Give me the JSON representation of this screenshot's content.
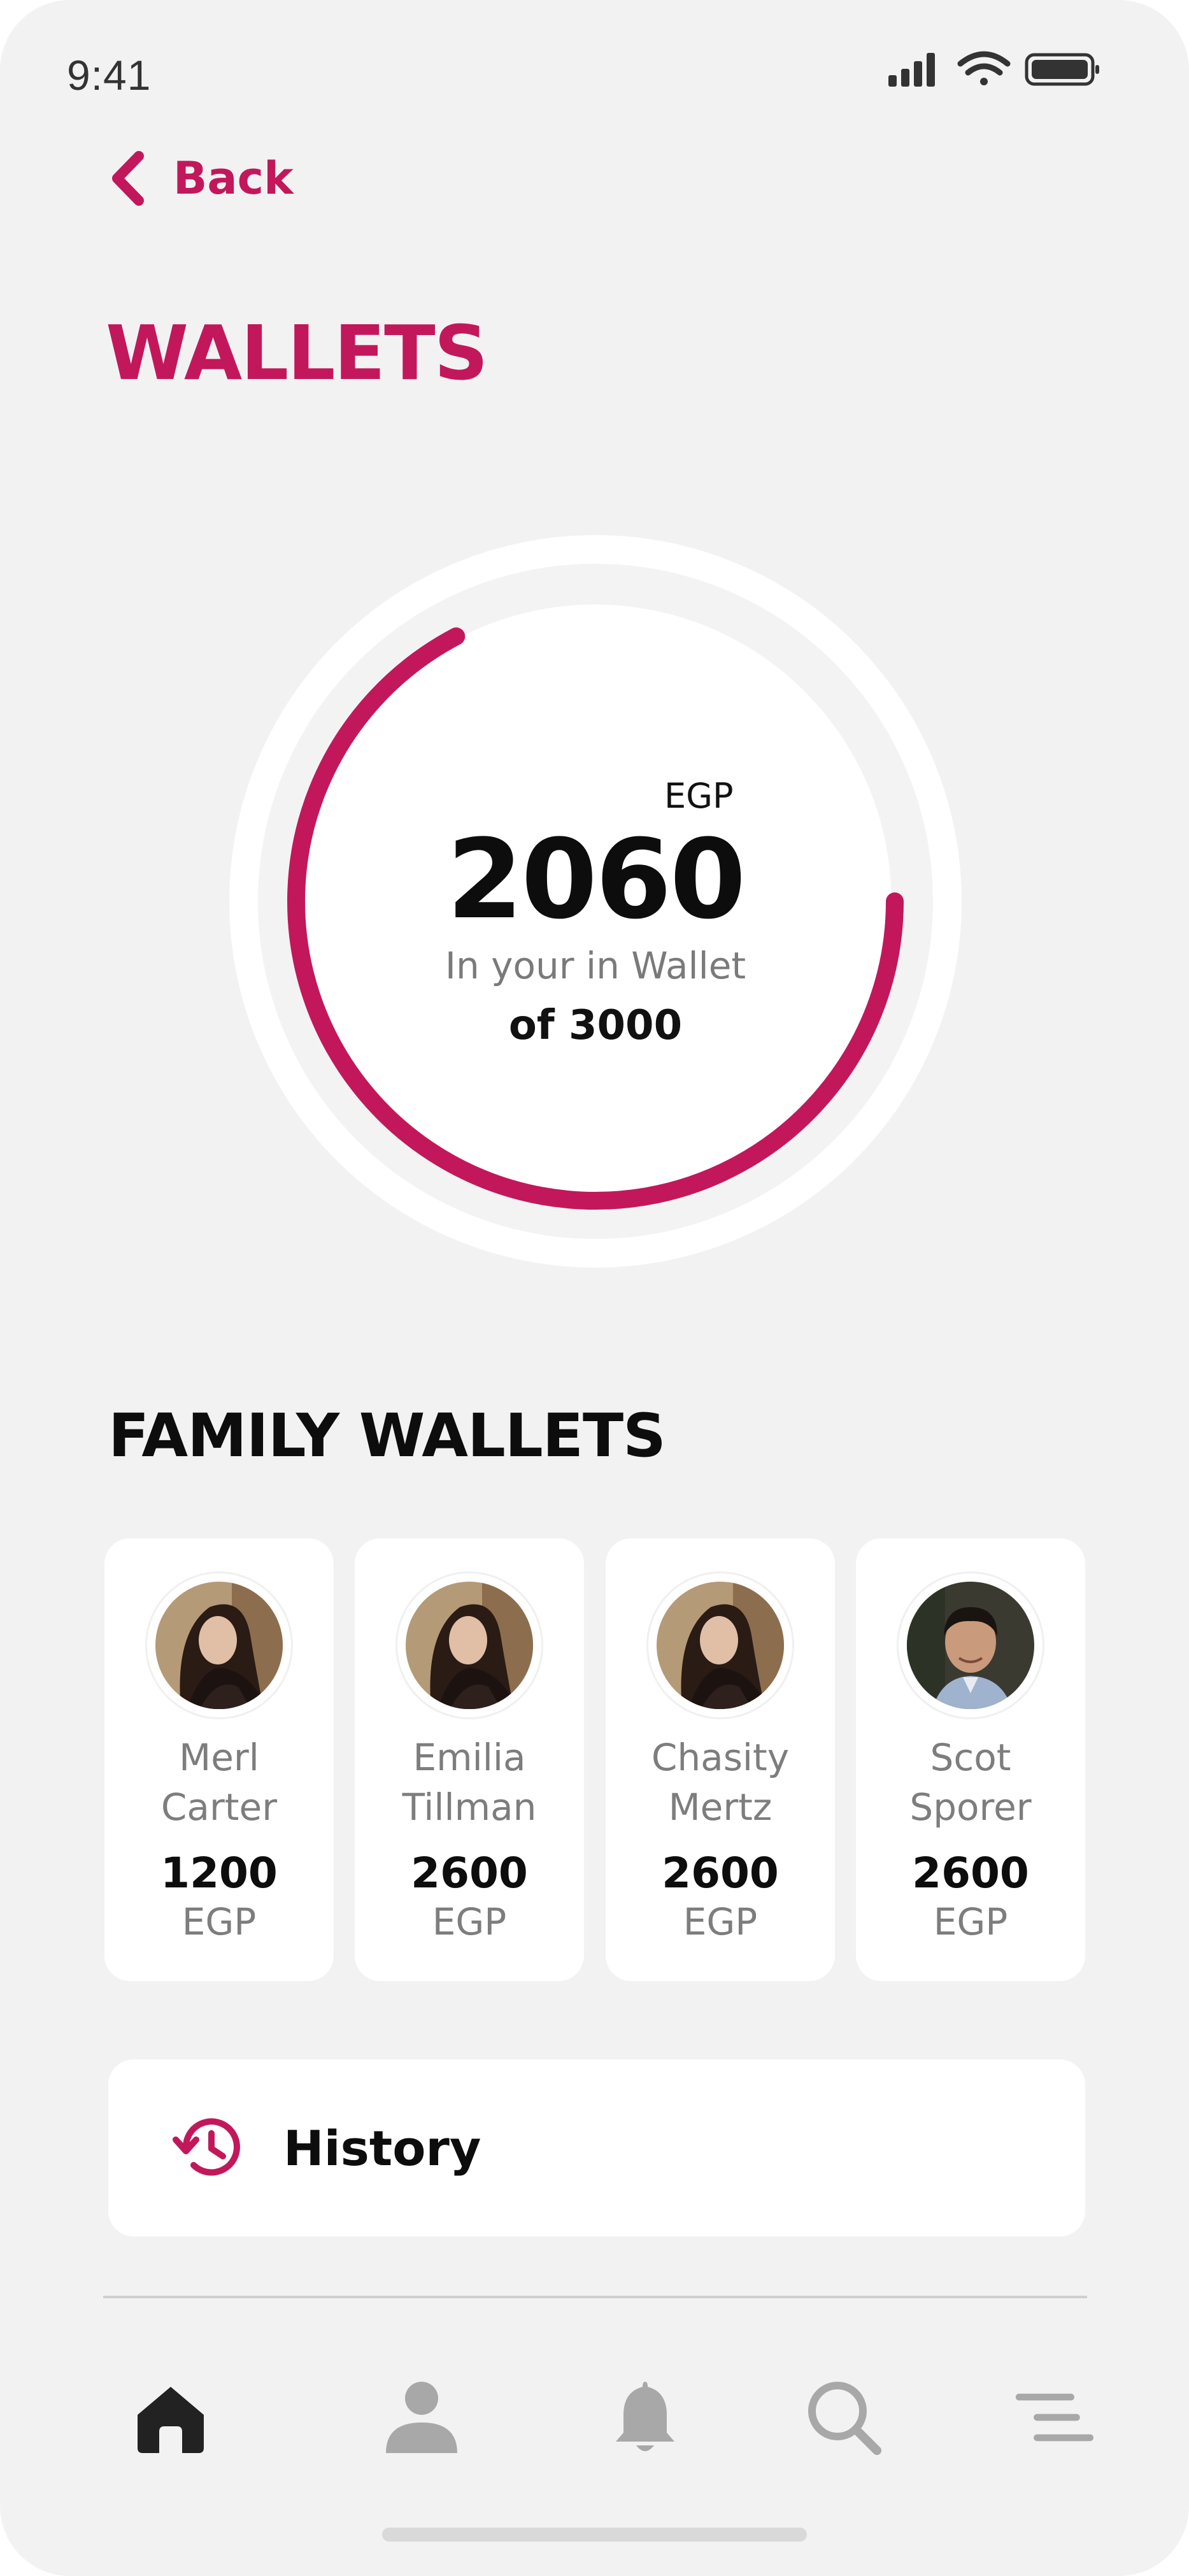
{
  "status_bar": {
    "time": "9:41"
  },
  "header": {
    "back_label": "Back",
    "title": "WALLETS"
  },
  "wallet": {
    "currency": "EGP",
    "amount": "2060",
    "subtitle": "In your in Wallet",
    "of_label": "of 3000",
    "progress_fraction": 0.6867,
    "accent_color": "#c2185b"
  },
  "family": {
    "title": "FAMILY WALLETS",
    "members": [
      {
        "first": "Merl",
        "last": "Carter",
        "amount": "1200",
        "currency": "EGP"
      },
      {
        "first": "Emilia",
        "last": "Tillman",
        "amount": "2600",
        "currency": "EGP"
      },
      {
        "first": "Chasity",
        "last": "Mertz",
        "amount": "2600",
        "currency": "EGP"
      },
      {
        "first": "Scot",
        "last": "Sporer",
        "amount": "2600",
        "currency": "EGP"
      }
    ]
  },
  "history": {
    "label": "History",
    "icon": "history-icon"
  },
  "tabbar": {
    "items": [
      {
        "icon": "home-icon",
        "active": true
      },
      {
        "icon": "user-icon",
        "active": false
      },
      {
        "icon": "bell-icon",
        "active": false
      },
      {
        "icon": "search-icon",
        "active": false
      },
      {
        "icon": "menu-icon",
        "active": false
      }
    ],
    "active_color": "#222222",
    "inactive_color": "#a8a8a8"
  }
}
